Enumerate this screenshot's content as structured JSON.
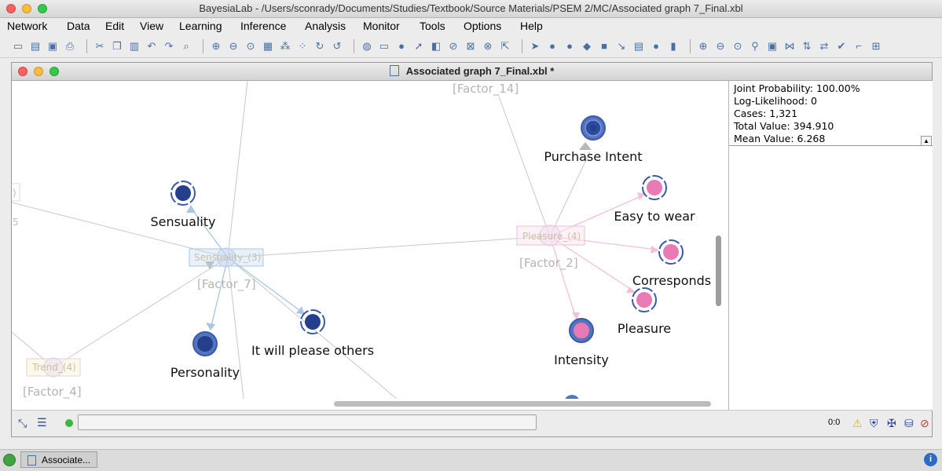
{
  "window": {
    "title": "BayesiaLab - /Users/sconrady/Documents/Studies/Textbook/Source Materials/PSEM 2/MC/Associated graph 7_Final.xbl"
  },
  "menu": [
    "Network",
    "Data",
    "Edit",
    "View",
    "Learning",
    "Inference",
    "Analysis",
    "Monitor",
    "Tools",
    "Options",
    "Help"
  ],
  "toolbar_icons": [
    "new-icon",
    "open-icon",
    "save-icon",
    "print-icon",
    "cut-icon",
    "copy-icon",
    "paste-icon",
    "undo-icon",
    "redo-icon",
    "find-icon",
    "zoom-in-icon",
    "zoom-out-icon",
    "zoom-fit-icon",
    "grid-icon",
    "layout-icon",
    "refresh-icon",
    "rotate-icon",
    "node-icon",
    "display-icon",
    "circle-icon",
    "arrow-icon",
    "color-icon",
    "hide-icon",
    "view-icon",
    "disabled-icon",
    "select-icon",
    "pointer-icon",
    "node-add-icon",
    "node-circle-icon",
    "diamond-icon",
    "square-icon",
    "arc-icon",
    "note-icon",
    "gray-icon",
    "trash-icon",
    "zoom-in-2-icon",
    "zoom-out-2-icon",
    "zoom-3-icon",
    "link-icon",
    "monitor-icon",
    "network-icon",
    "arrows-icon",
    "arrows-2-icon",
    "check-icon",
    "flag-icon",
    "plus-icon"
  ],
  "document": {
    "title": "Associated graph 7_Final.xbl *"
  },
  "graph": {
    "nodes": [
      {
        "label": "Sensuality",
        "color": "blue"
      },
      {
        "label": "Personality",
        "color": "blue"
      },
      {
        "label": "It will please others",
        "color": "blue"
      },
      {
        "label": "Purchase Intent",
        "color": "blue"
      },
      {
        "label": "Easy to wear",
        "color": "pink"
      },
      {
        "label": "Corresponds",
        "color": "pink"
      },
      {
        "label": "Pleasure",
        "color": "pink"
      },
      {
        "label": "Intensity",
        "color": "pink"
      }
    ],
    "factors": [
      {
        "box": "Sensuality_(3)",
        "name": "[Factor_7]"
      },
      {
        "box": "Pleasure_(4)",
        "name": "[Factor_2]"
      },
      {
        "box": "Trend_(4)",
        "name": "[Factor_4]"
      },
      {
        "box": "",
        "name": "[Factor_14]"
      }
    ],
    "partial_labels": [
      ")",
      "5"
    ]
  },
  "stats": {
    "joint_probability": "Joint Probability: 100.00%",
    "log_likelihood": "Log-Likelihood: 0",
    "cases": "Cases: 1,321",
    "total_value": "Total Value: 394.910",
    "mean_value": "Mean Value: 6.268"
  },
  "status": {
    "counter": "0:0"
  },
  "dock": {
    "item": "Associate..."
  },
  "colors": {
    "blue_node": "#253f8c",
    "pink_node": "#e87ab4",
    "edge": "#c8c8c8"
  }
}
